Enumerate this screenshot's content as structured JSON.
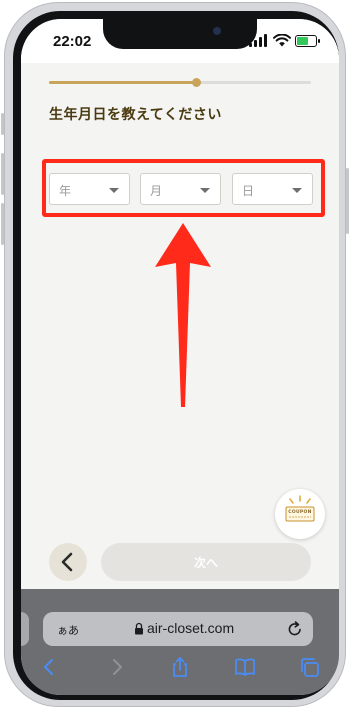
{
  "status_bar": {
    "time": "22:02"
  },
  "signup": {
    "progress_fraction": 0.56,
    "question": "生年月日を教えてください",
    "selects": [
      {
        "id": "year",
        "value": "年"
      },
      {
        "id": "month",
        "value": "月"
      },
      {
        "id": "day",
        "value": "日"
      }
    ],
    "coupon_label": "COUPON",
    "next_label": "次へ"
  },
  "browser": {
    "aa_label": "ぁあ",
    "url": "air-closet.com"
  },
  "colors": {
    "accent_gold": "#c8a45a",
    "highlight_red": "#ff2a1a",
    "safari_toolbar_tint": "#4a8cf5"
  },
  "icons": [
    "back-chevron-icon",
    "coupon-icon",
    "lock-icon",
    "reload-icon",
    "nav-back-icon",
    "nav-forward-icon",
    "share-icon",
    "bookmarks-icon",
    "tabs-icon",
    "wifi-icon",
    "signal-icon",
    "battery-icon"
  ]
}
